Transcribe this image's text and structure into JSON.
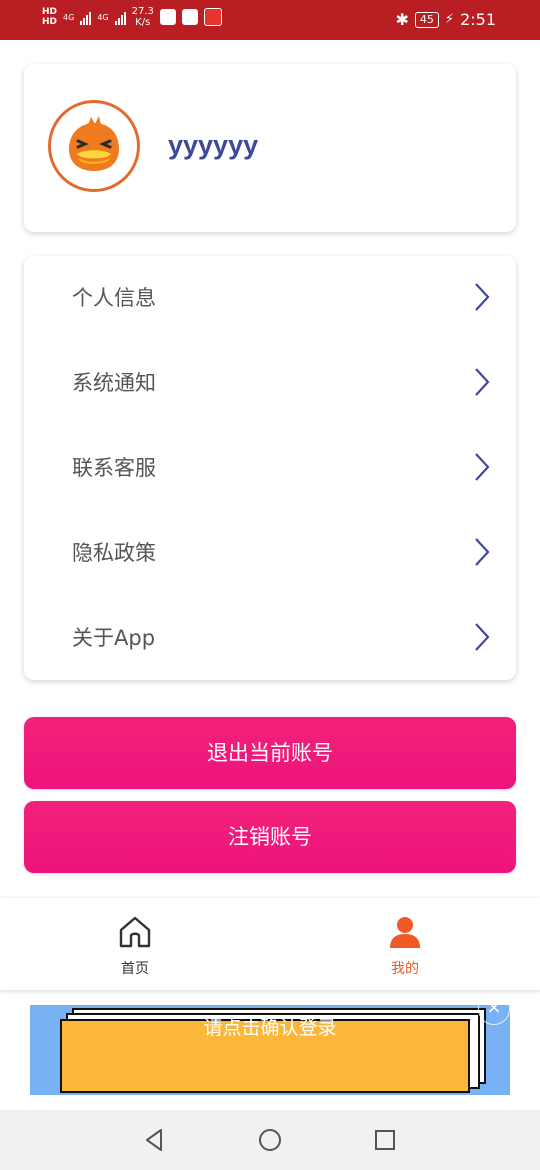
{
  "status_bar": {
    "network_speed": "27.3",
    "network_speed_unit": "K/s",
    "battery": "45",
    "time": "2:51",
    "network_type_1": "4G",
    "network_type_2": "4G"
  },
  "profile": {
    "username": "yyyyyy",
    "avatar_icon": "duck-face-icon"
  },
  "menu": {
    "items": [
      {
        "label": "个人信息"
      },
      {
        "label": "系统通知"
      },
      {
        "label": "联系客服"
      },
      {
        "label": "隐私政策"
      },
      {
        "label": "关于App"
      }
    ]
  },
  "actions": {
    "logout_label": "退出当前账号",
    "cancel_account_label": "注销账号"
  },
  "tabbar": {
    "home_label": "首页",
    "mine_label": "我的",
    "active": "mine"
  },
  "ad": {
    "text": "请点击确认登录",
    "close": "×"
  },
  "colors": {
    "status_bar": "#b91f22",
    "accent": "#ee137c",
    "tab_active": "#ee5a24",
    "username": "#3f4899",
    "chevron": "#3f4899"
  }
}
